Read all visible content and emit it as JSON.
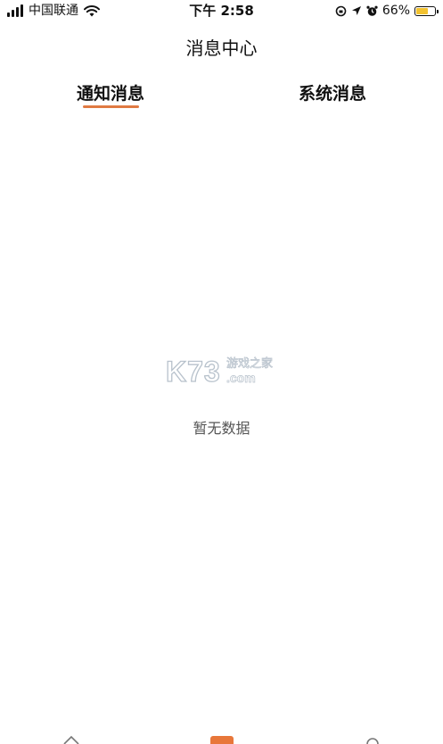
{
  "status_bar": {
    "carrier": "中国联通",
    "time": "下午 2:58",
    "battery": "66%",
    "battery_level": 0.66,
    "battery_color": "#f2c230"
  },
  "header": {
    "title": "消息中心"
  },
  "tabs": [
    {
      "label": "通知消息",
      "active": true
    },
    {
      "label": "系统消息",
      "active": false
    }
  ],
  "accent_color": "#e07a42",
  "watermark": {
    "main": "K73",
    "sub": "游戏之家",
    "domain": ".com"
  },
  "empty_state": {
    "text": "暂无数据"
  },
  "bottom_nav": {
    "icons": [
      "home-icon",
      "center-tab-icon",
      "profile-icon"
    ]
  }
}
